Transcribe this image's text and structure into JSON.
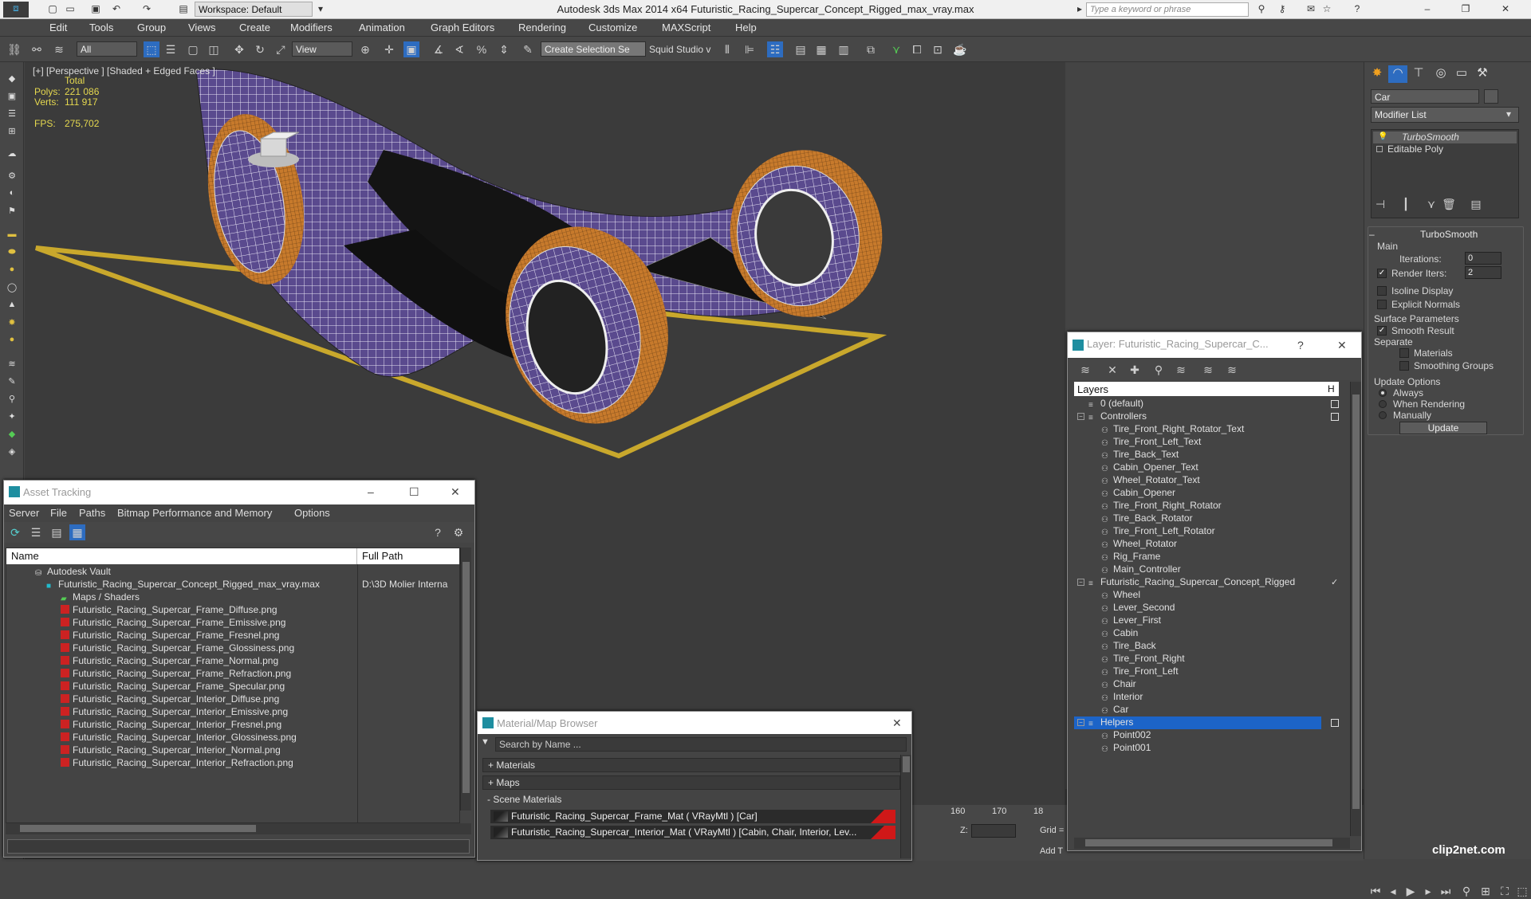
{
  "titlebar": {
    "title": "Autodesk 3ds Max  2014 x64     Futuristic_Racing_Supercar_Concept_Rigged_max_vray.max",
    "workspace": "Workspace: Default",
    "search_placeholder": "Type a keyword or phrase"
  },
  "menu": [
    "Edit",
    "Tools",
    "Group",
    "Views",
    "Create",
    "Modifiers",
    "Animation",
    "Graph Editors",
    "Rendering",
    "Customize",
    "MAXScript",
    "Help"
  ],
  "toolbar": {
    "filter": "All",
    "ref_coord": "View",
    "selection_set": "Create Selection Se",
    "squid": "Squid Studio v"
  },
  "viewport": {
    "label": "[+] [Perspective ] [Shaded + Edged Faces ]",
    "stats_header": "Total",
    "polys_label": "Polys:",
    "polys_value": "221 086",
    "verts_label": "Verts:",
    "verts_value": "111 917",
    "fps_label": "FPS:",
    "fps_value": "275,702"
  },
  "command_panel": {
    "object_name": "Car",
    "modifier_list": "Modifier List",
    "stack": [
      "TurboSmooth",
      "Editable Poly"
    ],
    "turbosmooth_title": "TurboSmooth",
    "main_label": "Main",
    "iterations_label": "Iterations:",
    "iterations_value": "0",
    "render_iters_label": "Render Iters:",
    "render_iters_value": "2",
    "isoline": "Isoline Display",
    "explicit_normals": "Explicit Normals",
    "surface_params": "Surface Parameters",
    "smooth_result": "Smooth Result",
    "separate": "Separate",
    "materials": "Materials",
    "smoothing_groups": "Smoothing Groups",
    "update_options": "Update Options",
    "always": "Always",
    "when_rendering": "When Rendering",
    "manually": "Manually",
    "update_button": "Update"
  },
  "asset_tracking": {
    "title": "Asset Tracking",
    "menu": [
      "Server",
      "File",
      "Paths",
      "Bitmap Performance and Memory",
      "Options"
    ],
    "col_name": "Name",
    "col_path": "Full Path",
    "vault": "Autodesk Vault",
    "max_file": "Futuristic_Racing_Supercar_Concept_Rigged_max_vray.max",
    "max_path": "D:\\3D Molier Interna",
    "maps_folder": "Maps / Shaders",
    "files": [
      "Futuristic_Racing_Supercar_Frame_Diffuse.png",
      "Futuristic_Racing_Supercar_Frame_Emissive.png",
      "Futuristic_Racing_Supercar_Frame_Fresnel.png",
      "Futuristic_Racing_Supercar_Frame_Glossiness.png",
      "Futuristic_Racing_Supercar_Frame_Normal.png",
      "Futuristic_Racing_Supercar_Frame_Refraction.png",
      "Futuristic_Racing_Supercar_Frame_Specular.png",
      "Futuristic_Racing_Supercar_Interior_Diffuse.png",
      "Futuristic_Racing_Supercar_Interior_Emissive.png",
      "Futuristic_Racing_Supercar_Interior_Fresnel.png",
      "Futuristic_Racing_Supercar_Interior_Glossiness.png",
      "Futuristic_Racing_Supercar_Interior_Normal.png",
      "Futuristic_Racing_Supercar_Interior_Refraction.png"
    ]
  },
  "material_browser": {
    "title": "Material/Map Browser",
    "search_placeholder": "Search by Name ...",
    "materials": "+ Materials",
    "maps": "+ Maps",
    "scene_materials": "- Scene Materials",
    "rows": [
      "Futuristic_Racing_Supercar_Frame_Mat  ( VRayMtl )  [Car]",
      "Futuristic_Racing_Supercar_Interior_Mat  ( VRayMtl )  [Cabin, Chair, Interior, Lev..."
    ]
  },
  "layers": {
    "title": "Layer: Futuristic_Racing_Supercar_C...",
    "col_layers": "Layers",
    "col_h": "H",
    "rows": [
      {
        "text": "0 (default)",
        "level": 1,
        "type": "layer"
      },
      {
        "text": "Controllers",
        "level": 1,
        "type": "layer"
      },
      {
        "text": "Tire_Front_Right_Rotator_Text",
        "level": 2,
        "type": "node"
      },
      {
        "text": "Tire_Front_Left_Text",
        "level": 2,
        "type": "node"
      },
      {
        "text": "Tire_Back_Text",
        "level": 2,
        "type": "node"
      },
      {
        "text": "Cabin_Opener_Text",
        "level": 2,
        "type": "node"
      },
      {
        "text": "Wheel_Rotator_Text",
        "level": 2,
        "type": "node"
      },
      {
        "text": "Cabin_Opener",
        "level": 2,
        "type": "node"
      },
      {
        "text": "Tire_Front_Right_Rotator",
        "level": 2,
        "type": "node"
      },
      {
        "text": "Tire_Back_Rotator",
        "level": 2,
        "type": "node"
      },
      {
        "text": "Tire_Front_Left_Rotator",
        "level": 2,
        "type": "node"
      },
      {
        "text": "Wheel_Rotator",
        "level": 2,
        "type": "node"
      },
      {
        "text": "Rig_Frame",
        "level": 2,
        "type": "node"
      },
      {
        "text": "Main_Controller",
        "level": 2,
        "type": "node"
      },
      {
        "text": "Futuristic_Racing_Supercar_Concept_Rigged",
        "level": 1,
        "type": "layer"
      },
      {
        "text": "Wheel",
        "level": 2,
        "type": "node"
      },
      {
        "text": "Lever_Second",
        "level": 2,
        "type": "node"
      },
      {
        "text": "Lever_First",
        "level": 2,
        "type": "node"
      },
      {
        "text": "Cabin",
        "level": 2,
        "type": "node"
      },
      {
        "text": "Tire_Back",
        "level": 2,
        "type": "node"
      },
      {
        "text": "Tire_Front_Right",
        "level": 2,
        "type": "node"
      },
      {
        "text": "Tire_Front_Left",
        "level": 2,
        "type": "node"
      },
      {
        "text": "Chair",
        "level": 2,
        "type": "node"
      },
      {
        "text": "Interior",
        "level": 2,
        "type": "node"
      },
      {
        "text": "Car",
        "level": 2,
        "type": "node"
      },
      {
        "text": "Helpers",
        "level": 1,
        "type": "layer"
      },
      {
        "text": "Point002",
        "level": 2,
        "type": "node"
      },
      {
        "text": "Point001",
        "level": 2,
        "type": "node"
      }
    ]
  },
  "timeline": {
    "tick_160": "160",
    "tick_170": "170",
    "tick_18": "18",
    "z_label": "Z:",
    "grid_label": "Grid =",
    "add_t": "Add T"
  },
  "watermark": "clip2net.com",
  "colors": {
    "ui_bg": "#474747",
    "viewport_bg": "#3b3b3b",
    "selection": "#1c64c8",
    "stats": "#e5d84f",
    "grid_outline": "#c9a82c",
    "car_body": "#5a4a8e",
    "tire": "#c77a2c"
  }
}
